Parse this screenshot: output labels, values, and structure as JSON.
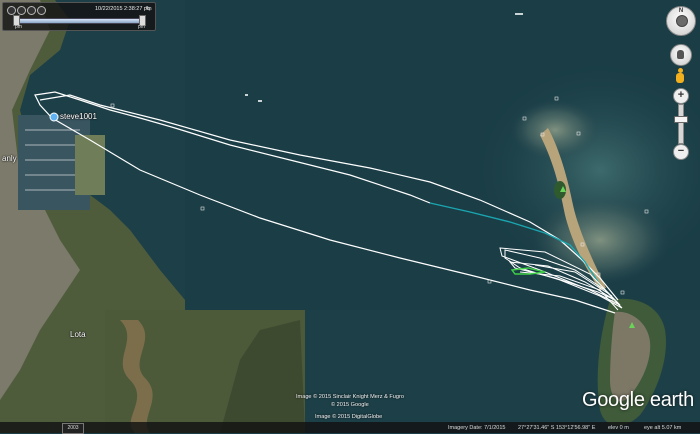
{
  "app": "Google Earth",
  "time_slider": {
    "range_label": "10/22/2015 2:38:27 pm",
    "start_label": "pm",
    "end_label": "pm"
  },
  "labels": {
    "placemark": "steve1001",
    "town_left_edge": "anly",
    "town_lota": "Lota"
  },
  "attribution": {
    "line1": "Image © 2015 Sinclair Knight Merz & Fugro",
    "line2": "© 2015 Google",
    "line3": "Image © 2015 DigitalGlobe"
  },
  "branding": "Google earth",
  "map_logo": "2003",
  "status_bar": {
    "imagery_date": "Imagery Date: 7/1/2015",
    "coordinates": "27°27'31.46\" S  153°12'56.98\" E",
    "elevation": "elev 0 m",
    "eye_alt": "eye alt  5.07 km"
  },
  "colors": {
    "water": "#1d4048",
    "track": "#ffffff",
    "track_highlight": "#1aa6b0",
    "track_green": "#3ecf45",
    "sand": "#c7b48a"
  }
}
